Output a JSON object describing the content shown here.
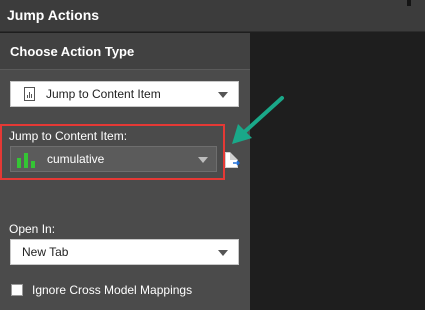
{
  "window": {
    "title": "Jump Actions"
  },
  "panel": {
    "header": "Choose Action Type"
  },
  "action_type": {
    "value": "Jump to Content Item",
    "icon": "report-icon"
  },
  "content_item": {
    "label": "Jump to Content Item:",
    "value": "cumulative",
    "icon": "bar-chart-icon",
    "icon_color": "#34c534",
    "open_icon": "open-content-item-icon"
  },
  "open_in": {
    "label": "Open In:",
    "value": "New Tab"
  },
  "ignore_cross_model": {
    "label": "Ignore Cross Model Mappings",
    "checked": false
  },
  "annotations": {
    "highlight_color": "#e53935",
    "arrow_color": "#1aa889"
  }
}
